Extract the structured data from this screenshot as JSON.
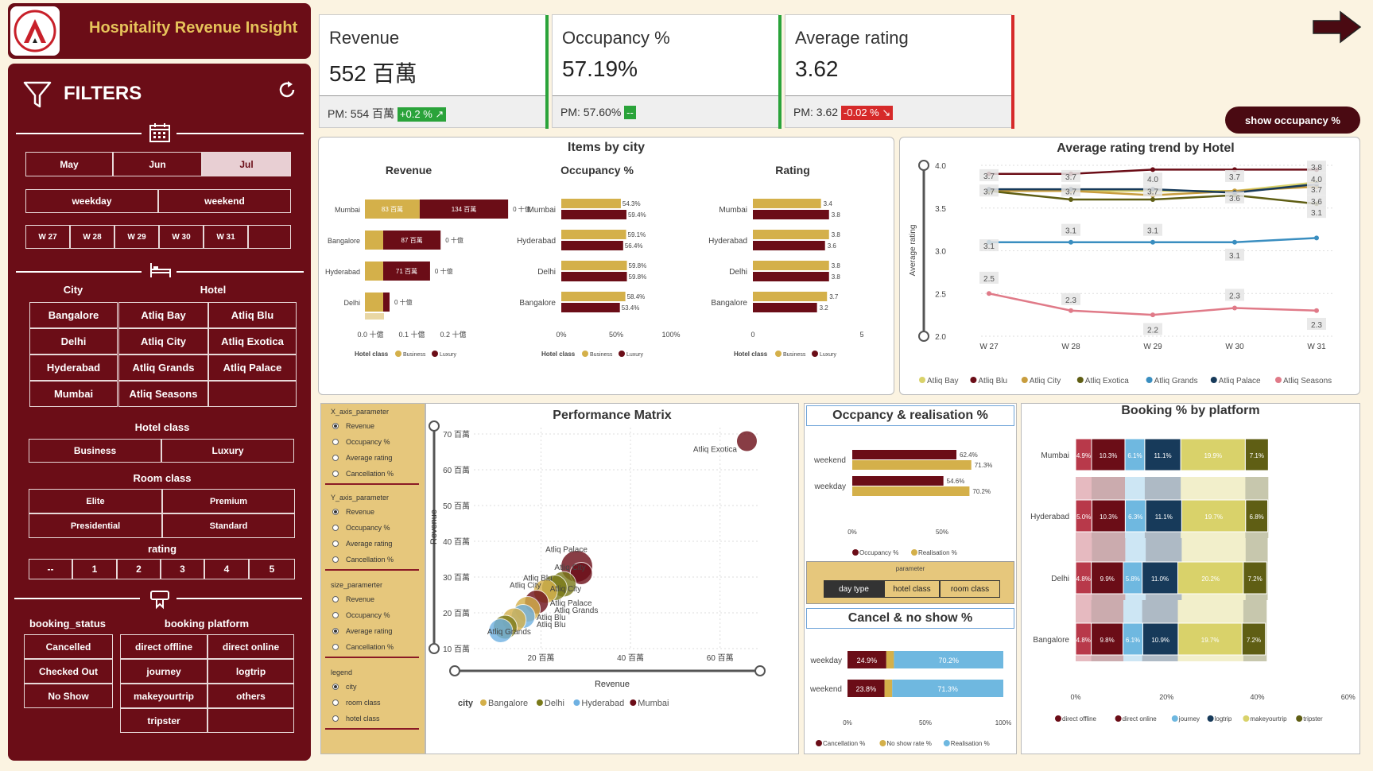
{
  "app_title": "Hospitality Revenue Insight",
  "filters": {
    "title": "FILTERS",
    "months": [
      "May",
      "Jun",
      "Jul"
    ],
    "selected_month": "Jul",
    "day_types": [
      "weekday",
      "weekend"
    ],
    "weeks": [
      "W 27",
      "W 28",
      "W 29",
      "W 30",
      "W 31"
    ],
    "city_label": "City",
    "hotel_label": "Hotel",
    "cities": [
      "Bangalore",
      "Delhi",
      "Hyderabad",
      "Mumbai"
    ],
    "hotels": [
      "Atliq Bay",
      "Atliq Blu",
      "Atliq City",
      "Atliq Exotica",
      "Atliq Grands",
      "Atliq Palace",
      "Atliq Seasons"
    ],
    "hotel_class_label": "Hotel class",
    "hotel_classes": [
      "Business",
      "Luxury"
    ],
    "room_class_label": "Room class",
    "room_classes": [
      "Elite",
      "Premium",
      "Presidential",
      "Standard"
    ],
    "rating_label": "rating",
    "ratings": [
      "--",
      "1",
      "2",
      "3",
      "4",
      "5"
    ],
    "booking_status_label": "booking_status",
    "booking_statuses": [
      "Cancelled",
      "Checked Out",
      "No Show"
    ],
    "booking_platform_label": "booking platform",
    "booking_platforms": [
      "direct offline",
      "direct online",
      "journey",
      "logtrip",
      "makeyourtrip",
      "others",
      "tripster"
    ]
  },
  "kpis": [
    {
      "title": "Revenue",
      "value": "552 百萬",
      "pm": "PM: 554 百萬",
      "delta": "+0.2 % ↗",
      "delta_color": "#2aa33a",
      "bar_color": "#2aa33a"
    },
    {
      "title": "Occupancy %",
      "value": "57.19%",
      "pm": "PM: 57.60%",
      "delta": "--",
      "delta_color": "#2aa33a",
      "bar_color": "#2aa33a"
    },
    {
      "title": "Average rating",
      "value": "3.62",
      "pm": "PM: 3.62",
      "delta": "-0.02 % ↘",
      "delta_color": "#d62a2a",
      "bar_color": "#d62a2a"
    }
  ],
  "show_occupancy_button": "show occupancy %",
  "items_by_city": {
    "title": "Items by city",
    "legend_label": "Hotel class",
    "legend": [
      "Business",
      "Luxury"
    ],
    "colors": {
      "business": "#d4b04a",
      "luxury": "#6b0d17"
    },
    "revenue": {
      "title": "Revenue",
      "cities": [
        "Mumbai",
        "Bangalore",
        "Hyderabad",
        "Delhi"
      ],
      "business": [
        83,
        0,
        0,
        0
      ],
      "luxury": [
        134,
        87,
        71,
        0
      ],
      "business_labels": [
        "83 百萬",
        "",
        "",
        ""
      ],
      "luxury_labels": [
        "134 百萬",
        "87 百萬",
        "71 百萬",
        ""
      ],
      "totals": [
        "0 十億",
        "0 十億",
        "0 十億",
        "0 十億"
      ],
      "ticks": [
        "0.0 十億",
        "0.1 十億",
        "0.2 十億"
      ]
    },
    "occupancy": {
      "title": "Occupancy %",
      "cities": [
        "Mumbai",
        "Hyderabad",
        "Delhi",
        "Bangalore"
      ],
      "business": [
        54.3,
        59.1,
        59.8,
        58.4
      ],
      "luxury": [
        59.4,
        56.4,
        59.8,
        53.4
      ],
      "business_labels": [
        "54.3%",
        "59.1%",
        "59.8%",
        "58.4%"
      ],
      "luxury_labels": [
        "59.4%",
        "56.4%",
        "59.8%",
        "53.4%"
      ],
      "ticks": [
        "0%",
        "50%",
        "100%"
      ]
    },
    "rating": {
      "title": "Rating",
      "cities": [
        "Mumbai",
        "Hyderabad",
        "Delhi",
        "Bangalore"
      ],
      "business": [
        3.4,
        3.8,
        3.8,
        3.7
      ],
      "luxury": [
        3.8,
        3.6,
        3.8,
        3.2
      ],
      "business_labels": [
        "3.4",
        "3.8",
        "3.8",
        "3.7"
      ],
      "luxury_labels": [
        "3.8",
        "3.6",
        "3.8",
        "3.2"
      ],
      "ticks": [
        "0",
        "5"
      ]
    }
  },
  "chart_data": [
    {
      "type": "line",
      "title": "Average rating trend by Hotel",
      "ylabel": "Average rating",
      "ylim": [
        2.0,
        4.0
      ],
      "yticks": [
        "2.0",
        "2.5",
        "3.0",
        "3.5",
        "4.0"
      ],
      "x": [
        "W 27",
        "W 28",
        "W 29",
        "W 30",
        "W 31"
      ],
      "series": [
        {
          "name": "Atliq Bay",
          "color": "#d9d26a",
          "values": [
            3.7,
            3.7,
            3.7,
            3.7,
            3.8
          ]
        },
        {
          "name": "Atliq Blu",
          "color": "#6b0d17",
          "values": [
            3.9,
            3.9,
            3.95,
            3.95,
            3.95
          ]
        },
        {
          "name": "Atliq City",
          "color": "#c89d3e",
          "values": [
            3.7,
            3.7,
            3.65,
            3.7,
            3.75
          ]
        },
        {
          "name": "Atliq Exotica",
          "color": "#5f5e14",
          "values": [
            3.7,
            3.6,
            3.6,
            3.65,
            3.55
          ]
        },
        {
          "name": "Atliq Grands",
          "color": "#3a8ec0",
          "values": [
            3.1,
            3.1,
            3.1,
            3.1,
            3.15
          ]
        },
        {
          "name": "Atliq Palace",
          "color": "#173a5a",
          "values": [
            3.72,
            3.72,
            3.72,
            3.68,
            3.78
          ]
        },
        {
          "name": "Atliq Seasons",
          "color": "#e07a88",
          "values": [
            2.5,
            2.3,
            2.25,
            2.33,
            2.3
          ]
        }
      ],
      "point_labels": [
        {
          "x": "W 27",
          "y": 3.88,
          "t": "3.7"
        },
        {
          "x": "W 27",
          "y": 3.7,
          "t": "3.7"
        },
        {
          "x": "W 27",
          "y": 3.06,
          "t": "3.1"
        },
        {
          "x": "W 27",
          "y": 2.68,
          "t": "2.5"
        },
        {
          "x": "W 28",
          "y": 3.87,
          "t": "3.7"
        },
        {
          "x": "W 28",
          "y": 3.7,
          "t": "3.7"
        },
        {
          "x": "W 28",
          "y": 3.24,
          "t": "3.1"
        },
        {
          "x": "W 28",
          "y": 2.43,
          "t": "2.3"
        },
        {
          "x": "W 29",
          "y": 3.84,
          "t": "4.0"
        },
        {
          "x": "W 29",
          "y": 3.7,
          "t": "3.7"
        },
        {
          "x": "W 29",
          "y": 3.24,
          "t": "3.1"
        },
        {
          "x": "W 29",
          "y": 2.08,
          "t": "2.2"
        },
        {
          "x": "W 30",
          "y": 3.87,
          "t": "3.7"
        },
        {
          "x": "W 30",
          "y": 3.62,
          "t": "3.6"
        },
        {
          "x": "W 30",
          "y": 2.95,
          "t": "3.1"
        },
        {
          "x": "W 30",
          "y": 2.48,
          "t": "2.3"
        },
        {
          "x": "W 31",
          "y": 3.98,
          "t": "3.8"
        },
        {
          "x": "W 31",
          "y": 3.84,
          "t": "4.0"
        },
        {
          "x": "W 31",
          "y": 3.72,
          "t": "3.7"
        },
        {
          "x": "W 31",
          "y": 3.58,
          "t": "3.6"
        },
        {
          "x": "W 31",
          "y": 3.45,
          "t": "3.1"
        },
        {
          "x": "W 31",
          "y": 2.14,
          "t": "2.3"
        }
      ]
    },
    {
      "type": "scatter",
      "title": "Performance Matrix",
      "xlabel": "Revenue",
      "ylabel": "Revenue",
      "xticks": [
        "20 百萬",
        "40 百萬",
        "60 百萬"
      ],
      "yticks": [
        "10 百萬",
        "20 百萬",
        "30 百萬",
        "40 百萬",
        "50 百萬",
        "60 百萬",
        "70 百萬"
      ],
      "xlim": [
        5,
        70
      ],
      "ylim": [
        10,
        70
      ],
      "legend_label": "city",
      "legend": [
        {
          "name": "Bangalore",
          "color": "#d4b04a"
        },
        {
          "name": "Delhi",
          "color": "#7a7a1a"
        },
        {
          "name": "Hyderabad",
          "color": "#6fb1e2"
        },
        {
          "name": "Mumbai",
          "color": "#6b0d17"
        }
      ],
      "points": [
        {
          "label": "Atliq Exotica",
          "x": 66,
          "y": 68,
          "r": 13,
          "color": "#6b0d17",
          "lx": 54,
          "ly": 65
        },
        {
          "label": "Atliq Palace",
          "x": 28,
          "y": 33,
          "r": 20,
          "color": "#6b0d17",
          "lx": 21,
          "ly": 37
        },
        {
          "label": "Atliq City",
          "x": 29,
          "y": 31,
          "r": 14,
          "color": "#6b0d17",
          "lx": 23,
          "ly": 32
        },
        {
          "label": "Atliq City",
          "x": 25,
          "y": 28,
          "r": 16,
          "color": "#7a7a1a",
          "lx": 22,
          "ly": 26
        },
        {
          "label": "Atliq Blu",
          "x": 23,
          "y": 27,
          "r": 16,
          "color": "#7a7a1a",
          "lx": 16,
          "ly": 29
        },
        {
          "label": "Atliq City",
          "x": 21,
          "y": 26,
          "r": 15,
          "color": "#d4b04a",
          "lx": 13,
          "ly": 27
        },
        {
          "label": "Atliq Palace",
          "x": 19,
          "y": 23,
          "r": 15,
          "color": "#6b0d17",
          "lx": 22,
          "ly": 22
        },
        {
          "label": "Atliq Grands",
          "x": 17,
          "y": 21,
          "r": 16,
          "color": "#d4b04a",
          "lx": 23,
          "ly": 20
        },
        {
          "label": "Atliq Blu",
          "x": 16,
          "y": 19,
          "r": 15,
          "color": "#6fb1e2",
          "lx": 19,
          "ly": 18
        },
        {
          "label": "Atliq Blu",
          "x": 14,
          "y": 18,
          "r": 15,
          "color": "#d4b04a",
          "lx": 19,
          "ly": 16
        },
        {
          "label": "Atliq Grands",
          "x": 12,
          "y": 16,
          "r": 15,
          "color": "#7a7a1a",
          "lx": 8,
          "ly": 14
        },
        {
          "label": "",
          "x": 11,
          "y": 15,
          "r": 15,
          "color": "#6fb1e2",
          "lx": 0,
          "ly": 0
        }
      ]
    },
    {
      "type": "bar",
      "title": "Occpancy & realisation %",
      "categories": [
        "weekend",
        "weekday"
      ],
      "series": [
        {
          "name": "Occupancy %",
          "color": "#6b0d17",
          "values": [
            62.4,
            54.6
          ]
        },
        {
          "name": "Realisation %",
          "color": "#d4b04a",
          "values": [
            71.3,
            70.2
          ]
        }
      ],
      "xticks": [
        "0%",
        "50%"
      ]
    },
    {
      "type": "bar",
      "title": "Cancel & no show %",
      "categories": [
        "weekday",
        "weekend"
      ],
      "series": [
        {
          "name": "Cancellation %",
          "color": "#6b0d17",
          "values": [
            24.9,
            23.8
          ]
        },
        {
          "name": "No show rate %",
          "color": "#d4b04a",
          "values": [
            4.9,
            4.9
          ]
        },
        {
          "name": "Realisation %",
          "color": "#6fb8e0",
          "values": [
            70.2,
            71.3
          ]
        }
      ],
      "xticks": [
        "0%",
        "50%",
        "100%"
      ]
    },
    {
      "type": "bar",
      "title": "Booking % by platform",
      "categories": [
        "Mumbai",
        "Hyderabad",
        "Delhi",
        "Bangalore"
      ],
      "series": [
        {
          "name": "others",
          "color": "#b8394a",
          "values": [
            4.9,
            5.0,
            4.8,
            4.8
          ]
        },
        {
          "name": "direct offline",
          "color": "#6b0d17",
          "values": [
            10.3,
            10.3,
            9.9,
            9.8
          ]
        },
        {
          "name": "direct online",
          "color": "#6fb8e0",
          "values": [
            6.1,
            6.3,
            5.8,
            6.1
          ]
        },
        {
          "name": "journey",
          "color": "#173a5a",
          "values": [
            11.1,
            11.1,
            11.0,
            10.9
          ]
        },
        {
          "name": "logtrip",
          "color": "#d9d26a",
          "values": [
            19.9,
            19.7,
            20.2,
            19.7
          ]
        },
        {
          "name": "makeyourtrip",
          "color": "#5f5e14",
          "values": [
            7.1,
            6.8,
            7.2,
            7.2
          ]
        }
      ],
      "labels": [
        [
          "4.9%",
          "10.3%",
          "6.1%",
          "11.1%",
          "19.9%",
          "7.1%"
        ],
        [
          "5.0%",
          "10.3%",
          "6.3%",
          "11.1%",
          "19.7%",
          "6.8%"
        ],
        [
          "4.8%",
          "9.9%",
          "5.8%",
          "11.0%",
          "20.2%",
          "7.2%"
        ],
        [
          "4.8%",
          "9.8%",
          "6.1%",
          "10.9%",
          "19.7%",
          "7.2%"
        ]
      ],
      "xticks": [
        "0%",
        "20%",
        "40%",
        "60%"
      ],
      "legend": [
        "direct offline",
        "direct online",
        "journey",
        "logtrip",
        "makeyourtrip",
        "tripster"
      ]
    }
  ],
  "matrix_params": {
    "x_label": "X_axis_parameter",
    "y_label": "Y_axis_parameter",
    "size_label": "size_paramerter",
    "legend_label": "legend",
    "options": [
      "Revenue",
      "Occupancy %",
      "Average rating",
      "Cancellation %"
    ],
    "x_selected": "Revenue",
    "y_selected": "Revenue",
    "size_selected": "Average rating",
    "legend_options": [
      "city",
      "room class",
      "hotel class"
    ],
    "legend_selected": "city"
  },
  "occ_parameter": {
    "label": "parameter",
    "options": [
      "day type",
      "hotel class",
      "room class"
    ],
    "selected": "day type"
  }
}
